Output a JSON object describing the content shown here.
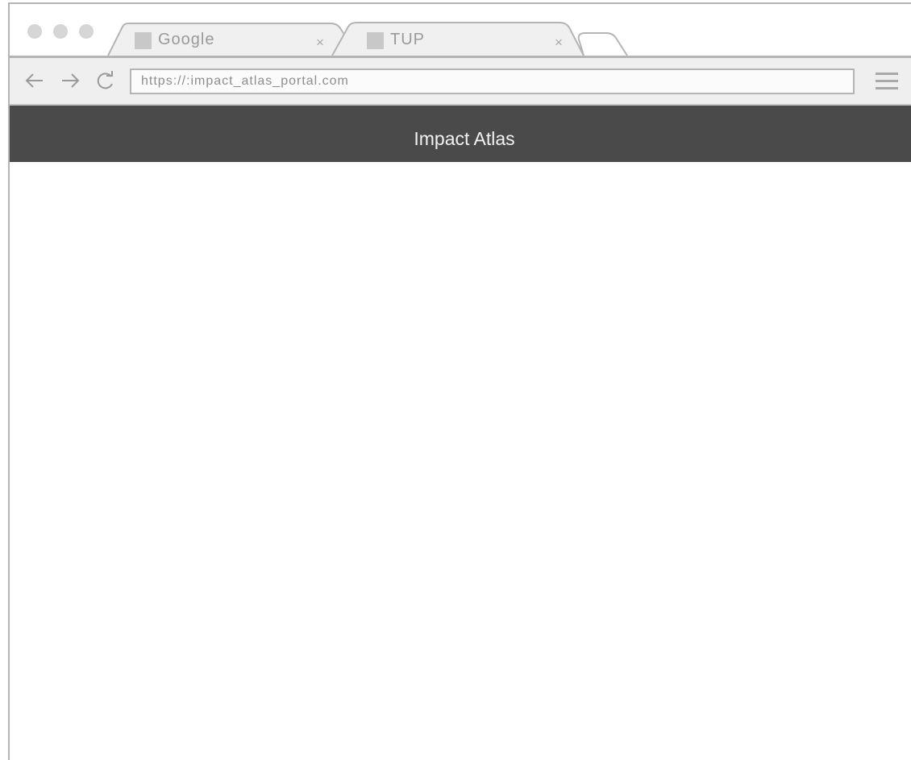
{
  "browser": {
    "tabs": [
      {
        "title": "Google",
        "close": "×"
      },
      {
        "title": "TUP",
        "close": "×"
      }
    ],
    "address_bar": {
      "url": "https://:impact_atlas_portal.com"
    },
    "nav": {
      "back": "←",
      "forward": "→",
      "reload": "C"
    }
  },
  "app": {
    "header_title": "Impact Atlas"
  }
}
